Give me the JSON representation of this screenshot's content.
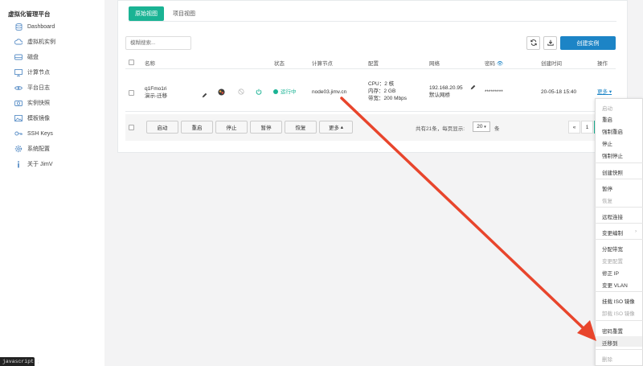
{
  "sidebar": {
    "title": "虚拟化管理平台",
    "items": [
      {
        "label": "Dashboard",
        "icon": "database-icon"
      },
      {
        "label": "虚拟机实例",
        "icon": "cloud-icon"
      },
      {
        "label": "磁盘",
        "icon": "hdd-icon"
      },
      {
        "label": "计算节点",
        "icon": "monitor-icon"
      },
      {
        "label": "平台日志",
        "icon": "eye-icon"
      },
      {
        "label": "实例快照",
        "icon": "camera-icon"
      },
      {
        "label": "模板镜像",
        "icon": "image-icon"
      },
      {
        "label": "SSH Keys",
        "icon": "key-icon"
      },
      {
        "label": "系统配置",
        "icon": "gear-icon"
      },
      {
        "label": "关于 JimV",
        "icon": "info-icon"
      }
    ]
  },
  "tabs": [
    {
      "label": "原始视图",
      "active": true
    },
    {
      "label": "项目视图",
      "active": false
    }
  ],
  "toolbar": {
    "search_placeholder": "模糊搜索...",
    "create_label": "创建实例"
  },
  "table": {
    "headers": [
      "名称",
      "状态",
      "计算节点",
      "配置",
      "网络",
      "密码",
      "创建时间",
      "操作"
    ],
    "row": {
      "name": "q1Fmo1ri",
      "desc": "演示-迁移",
      "status": "运行中",
      "node": "node03.jimv.cn",
      "cpu": "CPU：2 核",
      "mem": "内存：2 GB",
      "bw": "带宽：200 Mbps",
      "ip": "192.168.20.95",
      "net": "默认网桥",
      "password": "*********",
      "created": "20-05-18 15:40",
      "more": "更多"
    }
  },
  "footer": {
    "buttons": [
      "启动",
      "重启",
      "停止",
      "暂停",
      "恢复",
      "更多"
    ],
    "total_text": "共有21条，每页显示:",
    "page_size": "20",
    "unit": "条",
    "prev": "«",
    "page": "1"
  },
  "dropdown": {
    "groups": [
      [
        {
          "label": "启动",
          "disabled": true
        },
        {
          "label": "重启",
          "disabled": false
        },
        {
          "label": "强制重启",
          "disabled": false
        },
        {
          "label": "停止",
          "disabled": false
        },
        {
          "label": "强制停止",
          "disabled": false
        }
      ],
      [
        {
          "label": "创建快照",
          "disabled": false
        }
      ],
      [
        {
          "label": "暂停",
          "disabled": false
        },
        {
          "label": "恢复",
          "disabled": true
        }
      ],
      [
        {
          "label": "远程连接",
          "disabled": false
        }
      ],
      [
        {
          "label": "变更编制",
          "disabled": false
        }
      ],
      [
        {
          "label": "分配带宽",
          "disabled": false
        },
        {
          "label": "变更配置",
          "disabled": true
        },
        {
          "label": "修正 IP",
          "disabled": false
        },
        {
          "label": "变更 VLAN",
          "disabled": false
        }
      ],
      [
        {
          "label": "挂载 ISO 镜像",
          "disabled": false
        },
        {
          "label": "卸载 ISO 镜像",
          "disabled": true
        }
      ],
      [
        {
          "label": "密码重置",
          "disabled": false
        },
        {
          "label": "迁移到",
          "disabled": false
        }
      ],
      [
        {
          "label": "删除",
          "disabled": true
        }
      ]
    ]
  },
  "statusbar": "javascript:;",
  "colors": {
    "primary": "#1ab394",
    "accent": "#1c84c6",
    "arrow": "#e8452c"
  }
}
